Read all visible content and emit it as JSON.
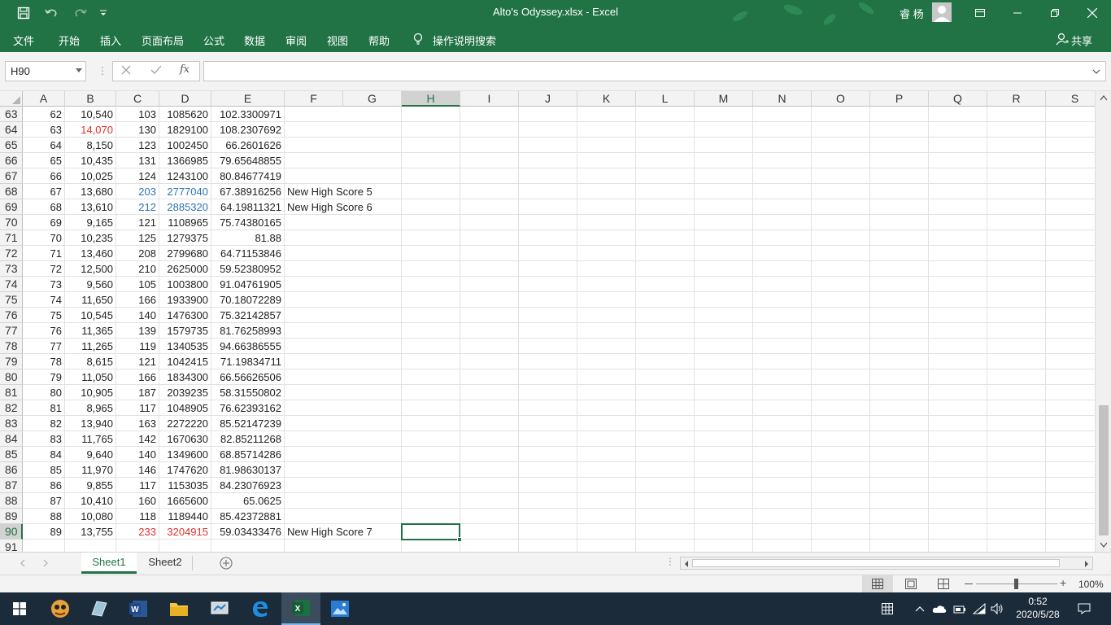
{
  "window": {
    "title": "Alto's Odyssey.xlsx  -  Excel",
    "user": "睿 杨"
  },
  "ribbon": {
    "tabs": [
      "文件",
      "开始",
      "插入",
      "页面布局",
      "公式",
      "数据",
      "审阅",
      "视图",
      "帮助"
    ],
    "tell_me": "操作说明搜索",
    "share": "共享"
  },
  "formula_bar": {
    "name_box": "H90",
    "fx": "fx",
    "value": ""
  },
  "columns": [
    "A",
    "B",
    "C",
    "D",
    "E",
    "F",
    "G",
    "H",
    "I",
    "J",
    "K",
    "L",
    "M",
    "N",
    "O",
    "P",
    "Q",
    "R",
    "S"
  ],
  "selected_column": "H",
  "rows": [
    {
      "n": "63",
      "a": "62",
      "b": "10,540",
      "c": "103",
      "d": "1085620",
      "e": "102.3300971",
      "f": ""
    },
    {
      "n": "64",
      "a": "63",
      "b": "14,070",
      "c": "130",
      "d": "1829100",
      "e": "108.2307692",
      "f": "",
      "b_color": "red"
    },
    {
      "n": "65",
      "a": "64",
      "b": "8,150",
      "c": "123",
      "d": "1002450",
      "e": "66.2601626",
      "f": ""
    },
    {
      "n": "66",
      "a": "65",
      "b": "10,435",
      "c": "131",
      "d": "1366985",
      "e": "79.65648855",
      "f": ""
    },
    {
      "n": "67",
      "a": "66",
      "b": "10,025",
      "c": "124",
      "d": "1243100",
      "e": "80.84677419",
      "f": ""
    },
    {
      "n": "68",
      "a": "67",
      "b": "13,680",
      "c": "203",
      "d": "2777040",
      "e": "67.38916256",
      "f": "New High Score 5",
      "cd_color": "blue"
    },
    {
      "n": "69",
      "a": "68",
      "b": "13,610",
      "c": "212",
      "d": "2885320",
      "e": "64.19811321",
      "f": "New High Score 6",
      "cd_color": "blue"
    },
    {
      "n": "70",
      "a": "69",
      "b": "9,165",
      "c": "121",
      "d": "1108965",
      "e": "75.74380165",
      "f": ""
    },
    {
      "n": "71",
      "a": "70",
      "b": "10,235",
      "c": "125",
      "d": "1279375",
      "e": "81.88",
      "f": ""
    },
    {
      "n": "72",
      "a": "71",
      "b": "13,460",
      "c": "208",
      "d": "2799680",
      "e": "64.71153846",
      "f": ""
    },
    {
      "n": "73",
      "a": "72",
      "b": "12,500",
      "c": "210",
      "d": "2625000",
      "e": "59.52380952",
      "f": ""
    },
    {
      "n": "74",
      "a": "73",
      "b": "9,560",
      "c": "105",
      "d": "1003800",
      "e": "91.04761905",
      "f": ""
    },
    {
      "n": "75",
      "a": "74",
      "b": "11,650",
      "c": "166",
      "d": "1933900",
      "e": "70.18072289",
      "f": ""
    },
    {
      "n": "76",
      "a": "75",
      "b": "10,545",
      "c": "140",
      "d": "1476300",
      "e": "75.32142857",
      "f": ""
    },
    {
      "n": "77",
      "a": "76",
      "b": "11,365",
      "c": "139",
      "d": "1579735",
      "e": "81.76258993",
      "f": ""
    },
    {
      "n": "78",
      "a": "77",
      "b": "11,265",
      "c": "119",
      "d": "1340535",
      "e": "94.66386555",
      "f": ""
    },
    {
      "n": "79",
      "a": "78",
      "b": "8,615",
      "c": "121",
      "d": "1042415",
      "e": "71.19834711",
      "f": ""
    },
    {
      "n": "80",
      "a": "79",
      "b": "11,050",
      "c": "166",
      "d": "1834300",
      "e": "66.56626506",
      "f": ""
    },
    {
      "n": "81",
      "a": "80",
      "b": "10,905",
      "c": "187",
      "d": "2039235",
      "e": "58.31550802",
      "f": ""
    },
    {
      "n": "82",
      "a": "81",
      "b": "8,965",
      "c": "117",
      "d": "1048905",
      "e": "76.62393162",
      "f": ""
    },
    {
      "n": "83",
      "a": "82",
      "b": "13,940",
      "c": "163",
      "d": "2272220",
      "e": "85.52147239",
      "f": ""
    },
    {
      "n": "84",
      "a": "83",
      "b": "11,765",
      "c": "142",
      "d": "1670630",
      "e": "82.85211268",
      "f": ""
    },
    {
      "n": "85",
      "a": "84",
      "b": "9,640",
      "c": "140",
      "d": "1349600",
      "e": "68.85714286",
      "f": ""
    },
    {
      "n": "86",
      "a": "85",
      "b": "11,970",
      "c": "146",
      "d": "1747620",
      "e": "81.98630137",
      "f": ""
    },
    {
      "n": "87",
      "a": "86",
      "b": "9,855",
      "c": "117",
      "d": "1153035",
      "e": "84.23076923",
      "f": ""
    },
    {
      "n": "88",
      "a": "87",
      "b": "10,410",
      "c": "160",
      "d": "1665600",
      "e": "65.0625",
      "f": ""
    },
    {
      "n": "89",
      "a": "88",
      "b": "10,080",
      "c": "118",
      "d": "1189440",
      "e": "85.42372881",
      "f": ""
    },
    {
      "n": "90",
      "a": "89",
      "b": "13,755",
      "c": "233",
      "d": "3204915",
      "e": "59.03433476",
      "f": "New High Score 7",
      "cd_color": "red"
    },
    {
      "n": "91",
      "a": "",
      "b": "",
      "c": "",
      "d": "",
      "e": "",
      "f": ""
    }
  ],
  "selected_row": "90",
  "sheets": [
    "Sheet1",
    "Sheet2"
  ],
  "active_sheet": "Sheet1",
  "status": {
    "zoom": "100%"
  },
  "taskbar": {
    "time": "0:52",
    "date": "2020/5/28"
  },
  "colors": {
    "excel_green": "#217346",
    "red_text": "#e0302a",
    "blue_text": "#2e75b6"
  }
}
